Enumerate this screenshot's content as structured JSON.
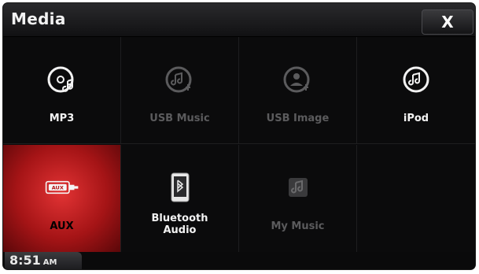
{
  "header": {
    "title": "Media",
    "close_label": "X"
  },
  "tiles": [
    {
      "label": "MP3",
      "state": "enabled",
      "icon": "mp3-icon"
    },
    {
      "label": "USB Music",
      "state": "disabled",
      "icon": "usb-music-icon"
    },
    {
      "label": "USB Image",
      "state": "disabled",
      "icon": "usb-image-icon"
    },
    {
      "label": "iPod",
      "state": "enabled",
      "icon": "ipod-icon"
    },
    {
      "label": "AUX",
      "state": "active",
      "icon": "aux-icon"
    },
    {
      "label": "Bluetooth\nAudio",
      "state": "enabled",
      "icon": "bluetooth-audio-icon"
    },
    {
      "label": "My Music",
      "state": "disabled",
      "icon": "my-music-icon"
    },
    {
      "label": "",
      "state": "empty",
      "icon": ""
    }
  ],
  "status": {
    "time": "8:51",
    "ampm": "AM"
  },
  "colors": {
    "accent": "#c31b1d",
    "background": "#0b0b0c",
    "label_enabled": "#f3f3f3",
    "label_disabled": "#5b5b5d"
  }
}
